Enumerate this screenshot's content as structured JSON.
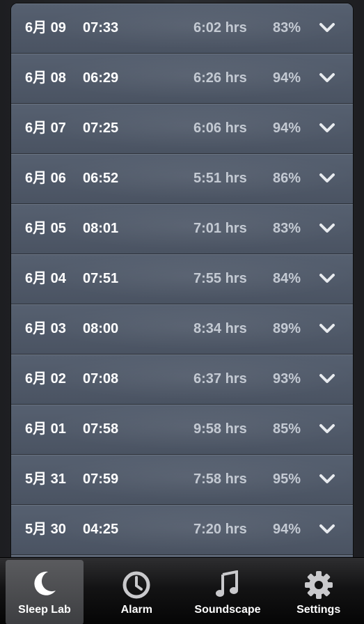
{
  "sleep_log": {
    "rows": [
      {
        "date": "6月 09",
        "wake": "07:33",
        "duration": "6:02 hrs",
        "quality": "83%"
      },
      {
        "date": "6月 08",
        "wake": "06:29",
        "duration": "6:26 hrs",
        "quality": "94%"
      },
      {
        "date": "6月 07",
        "wake": "07:25",
        "duration": "6:06 hrs",
        "quality": "94%"
      },
      {
        "date": "6月 06",
        "wake": "06:52",
        "duration": "5:51 hrs",
        "quality": "86%"
      },
      {
        "date": "6月 05",
        "wake": "08:01",
        "duration": "7:01 hrs",
        "quality": "83%"
      },
      {
        "date": "6月 04",
        "wake": "07:51",
        "duration": "7:55 hrs",
        "quality": "84%"
      },
      {
        "date": "6月 03",
        "wake": "08:00",
        "duration": "8:34 hrs",
        "quality": "89%"
      },
      {
        "date": "6月 02",
        "wake": "07:08",
        "duration": "6:37 hrs",
        "quality": "93%"
      },
      {
        "date": "6月 01",
        "wake": "07:58",
        "duration": "9:58 hrs",
        "quality": "85%"
      },
      {
        "date": "5月 31",
        "wake": "07:59",
        "duration": "7:58 hrs",
        "quality": "95%"
      },
      {
        "date": "5月 30",
        "wake": "04:25",
        "duration": "7:20 hrs",
        "quality": "94%"
      }
    ]
  },
  "tabbar": {
    "active": "sleep-lab",
    "tabs": [
      {
        "label": "Sleep Lab",
        "icon": "moon-icon"
      },
      {
        "label": "Alarm",
        "icon": "clock-icon"
      },
      {
        "label": "Soundscape",
        "icon": "music-note-icon"
      },
      {
        "label": "Settings",
        "icon": "gear-icon"
      }
    ]
  },
  "colors": {
    "row_primary_text": "#ffffff",
    "row_secondary_text": "#c4cad3",
    "row_background": "#4e5867",
    "tabbar_background": "#0a0a0a"
  }
}
